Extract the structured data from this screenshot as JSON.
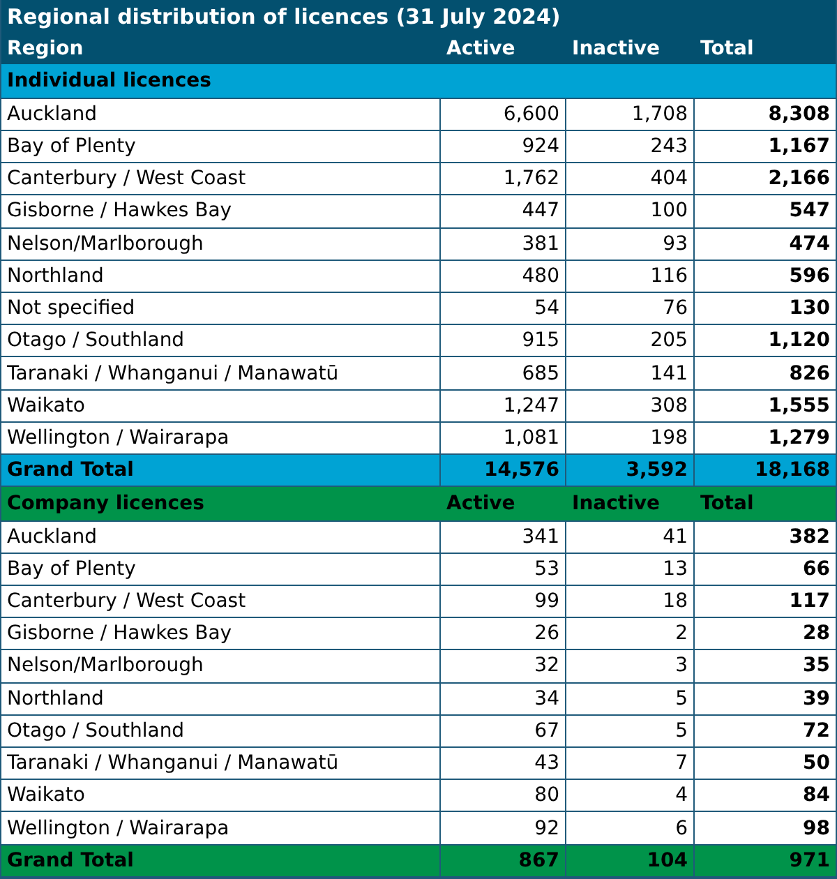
{
  "title": "Regional distribution of licences (31 July 2024)",
  "columns": [
    "Region",
    "Active",
    "Inactive",
    "Total"
  ],
  "sections": [
    {
      "title": "Individual licences",
      "color": "#00a3d4",
      "rows": [
        [
          "Auckland",
          "6,600",
          "1,708",
          "8,308"
        ],
        [
          "Bay of Plenty",
          "924",
          "243",
          "1,167"
        ],
        [
          "Canterbury / West Coast",
          "1,762",
          "404",
          "2,166"
        ],
        [
          "Gisborne / Hawkes Bay",
          "447",
          "100",
          "547"
        ],
        [
          "Nelson/Marlborough",
          "381",
          "93",
          "474"
        ],
        [
          "Northland",
          "480",
          "116",
          "596"
        ],
        [
          "Not specified",
          "54",
          "76",
          "130"
        ],
        [
          "Otago / Southland",
          "915",
          "205",
          "1,120"
        ],
        [
          "Taranaki / Whanganui / Manawatū",
          "685",
          "141",
          "826"
        ],
        [
          "Waikato",
          "1,247",
          "308",
          "1,555"
        ],
        [
          "Wellington / Wairarapa",
          "1,081",
          "198",
          "1,279"
        ]
      ],
      "total": [
        "Grand Total",
        "14,576",
        "3,592",
        "18,168"
      ]
    },
    {
      "title": "Company licences",
      "color": "#00934a",
      "columns": [
        "Active",
        "Inactive",
        "Total"
      ],
      "rows": [
        [
          "Auckland",
          "341",
          "41",
          "382"
        ],
        [
          "Bay of Plenty",
          "53",
          "13",
          "66"
        ],
        [
          "Canterbury / West Coast",
          "99",
          "18",
          "117"
        ],
        [
          "Gisborne / Hawkes Bay",
          "26",
          "2",
          "28"
        ],
        [
          "Nelson/Marlborough",
          "32",
          "3",
          "35"
        ],
        [
          "Northland",
          "34",
          "5",
          "39"
        ],
        [
          "Otago / Southland",
          "67",
          "5",
          "72"
        ],
        [
          "Taranaki / Whanganui / Manawatū",
          "43",
          "7",
          "50"
        ],
        [
          "Waikato",
          "80",
          "4",
          "84"
        ],
        [
          "Wellington / Wairarapa",
          "92",
          "6",
          "98"
        ]
      ],
      "total": [
        "Grand Total",
        "867",
        "104",
        "971"
      ]
    }
  ]
}
